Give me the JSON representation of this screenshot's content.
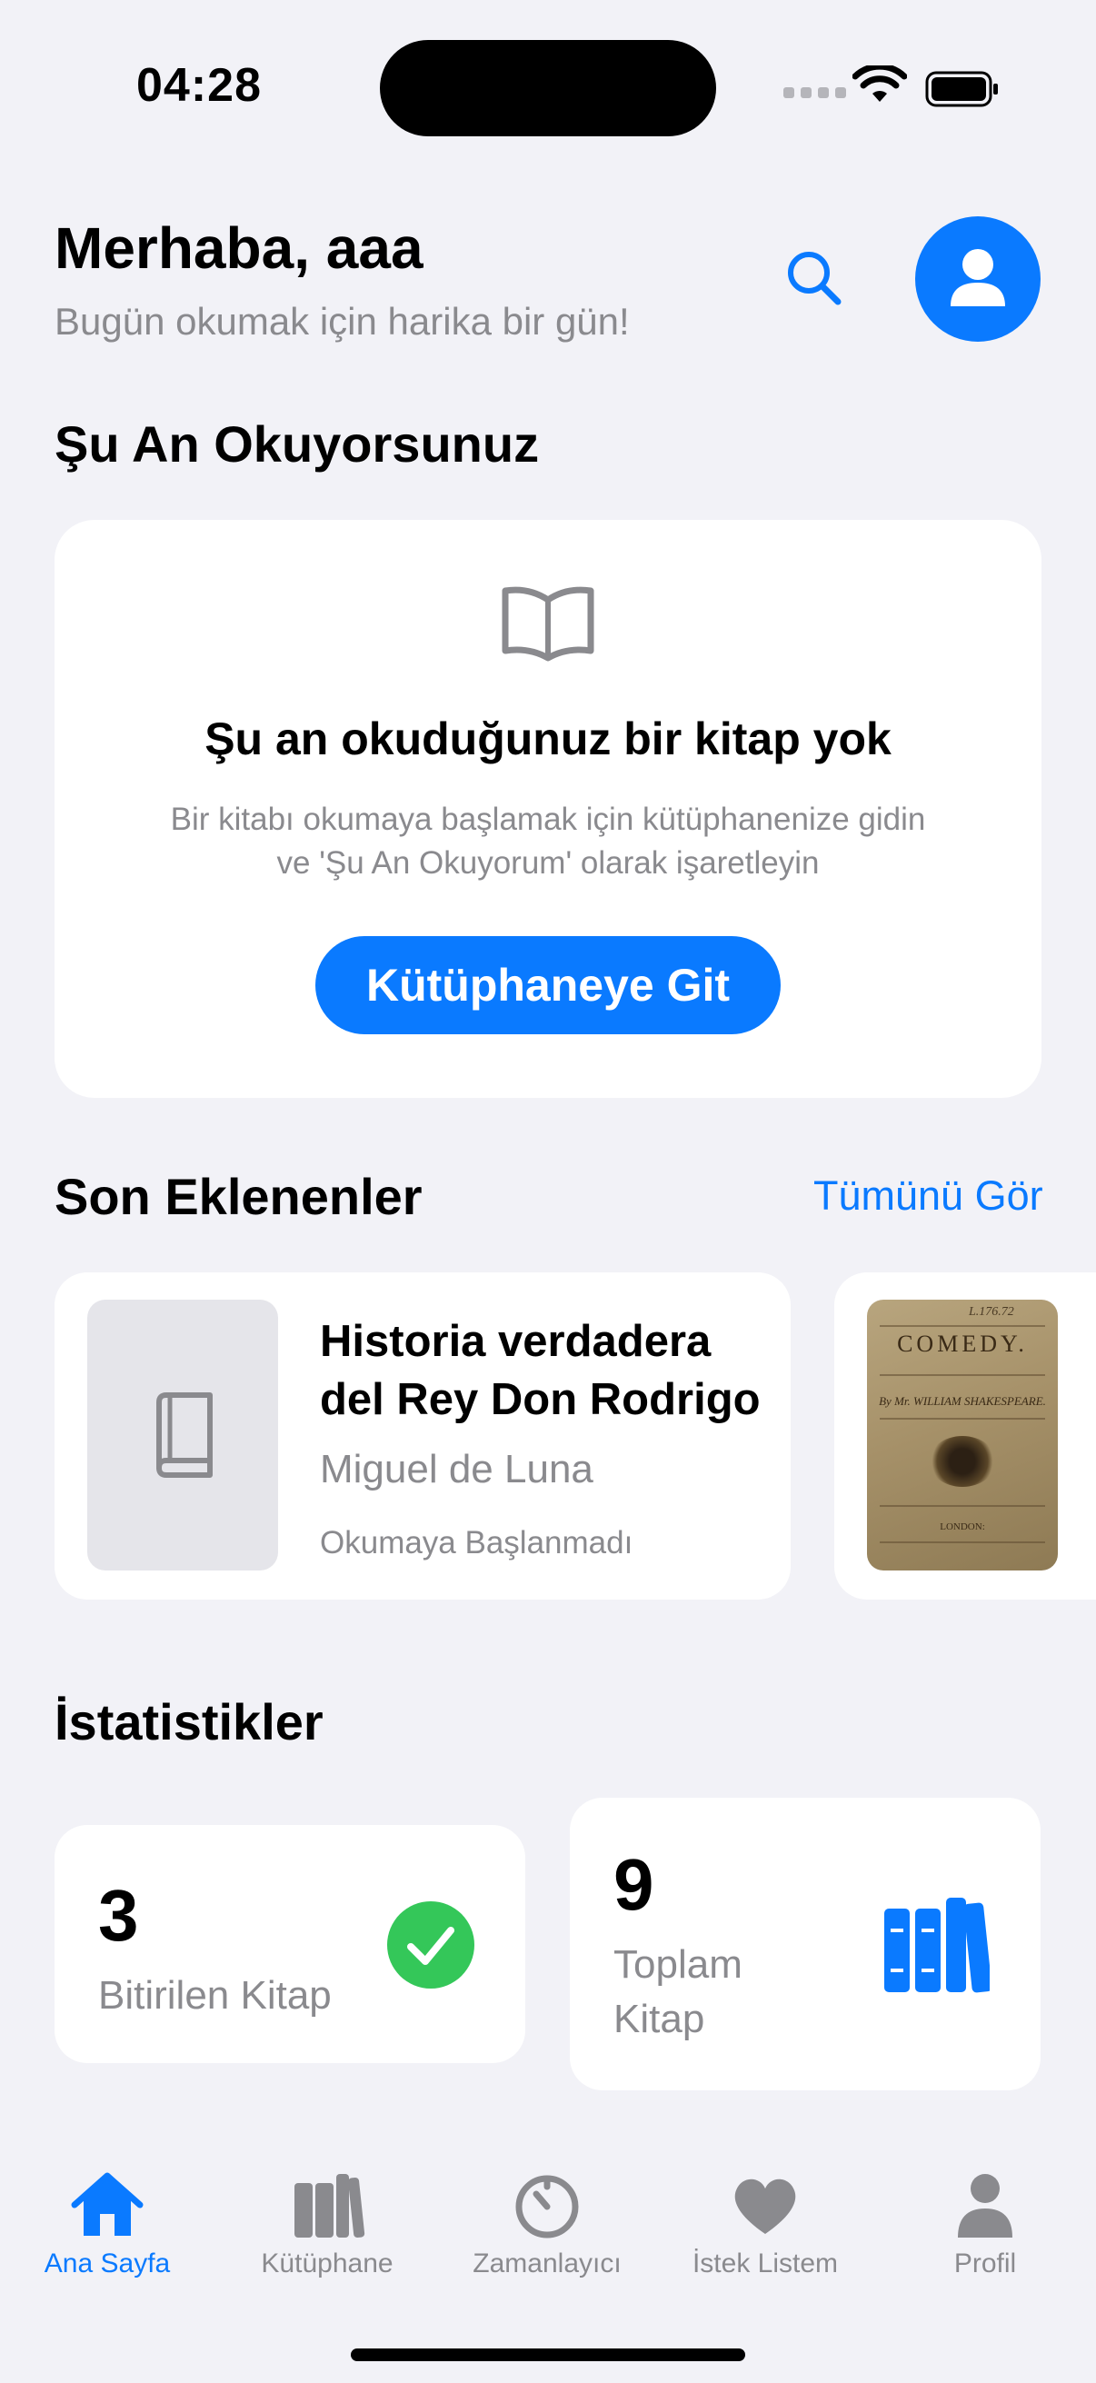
{
  "status_bar": {
    "time": "04:28"
  },
  "header": {
    "greeting": "Merhaba, aaa",
    "subtitle": "Bugün okumak için harika bir gün!",
    "search_icon": "magnifier-icon",
    "profile_icon": "person-icon"
  },
  "currently_reading": {
    "section_title": "Şu An Okuyorsunuz",
    "empty_title": "Şu an okuduğunuz bir kitap yok",
    "empty_description": "Bir kitabı okumaya başlamak için kütüphanenize gidin ve 'Şu An Okuyorum' olarak işaretleyin",
    "button_label": "Kütüphaneye Git"
  },
  "recently_added": {
    "section_title": "Son Eklenenler",
    "see_all_label": "Tümünü Gör",
    "books": [
      {
        "title": "Historia verdadera del Rey Don Rodrigo",
        "author": "Miguel de Luna",
        "status": "Okumaya Başlanmadı"
      },
      {
        "cover_heading": "COMEDY.",
        "cover_author_line": "By Mr. WILLIAM SHAKESPEARE.",
        "cover_place": "LONDON:",
        "cover_note": "L.176.72"
      }
    ]
  },
  "statistics": {
    "section_title": "İstatistikler",
    "finished": {
      "value": "3",
      "label": "Bitirilen Kitap"
    },
    "total": {
      "value": "9",
      "label": "Toplam Kitap"
    }
  },
  "tab_bar": {
    "active_index": 0,
    "items": [
      {
        "label": "Ana Sayfa",
        "icon": "house-icon"
      },
      {
        "label": "Kütüphane",
        "icon": "books-icon"
      },
      {
        "label": "Zamanlayıcı",
        "icon": "timer-icon"
      },
      {
        "label": "İstek Listem",
        "icon": "heart-icon"
      },
      {
        "label": "Profil",
        "icon": "person-icon"
      }
    ]
  },
  "colors": {
    "accent": "#0A7AFF",
    "background": "#F2F2F7",
    "success": "#34C759",
    "secondary_text": "#8A8A8E"
  }
}
